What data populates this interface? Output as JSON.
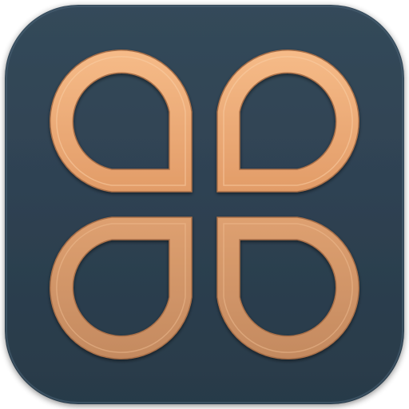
{
  "app_icon": {
    "icon_name": "four-teardrop-petals-icon",
    "colors": {
      "tile_background": "#2c3f4f",
      "tile_highlight": "#3d5366",
      "petal_light": "#f3b47f",
      "petal_mid": "#e9a470",
      "petal_dark": "#b97e57",
      "petal_edge": "#a96f48"
    },
    "petals": [
      {
        "id": "top-left",
        "pointed_corner": "bottom-right"
      },
      {
        "id": "top-right",
        "pointed_corner": "bottom-left"
      },
      {
        "id": "bottom-left",
        "pointed_corner": "top-right"
      },
      {
        "id": "bottom-right",
        "pointed_corner": "top-left"
      }
    ]
  }
}
